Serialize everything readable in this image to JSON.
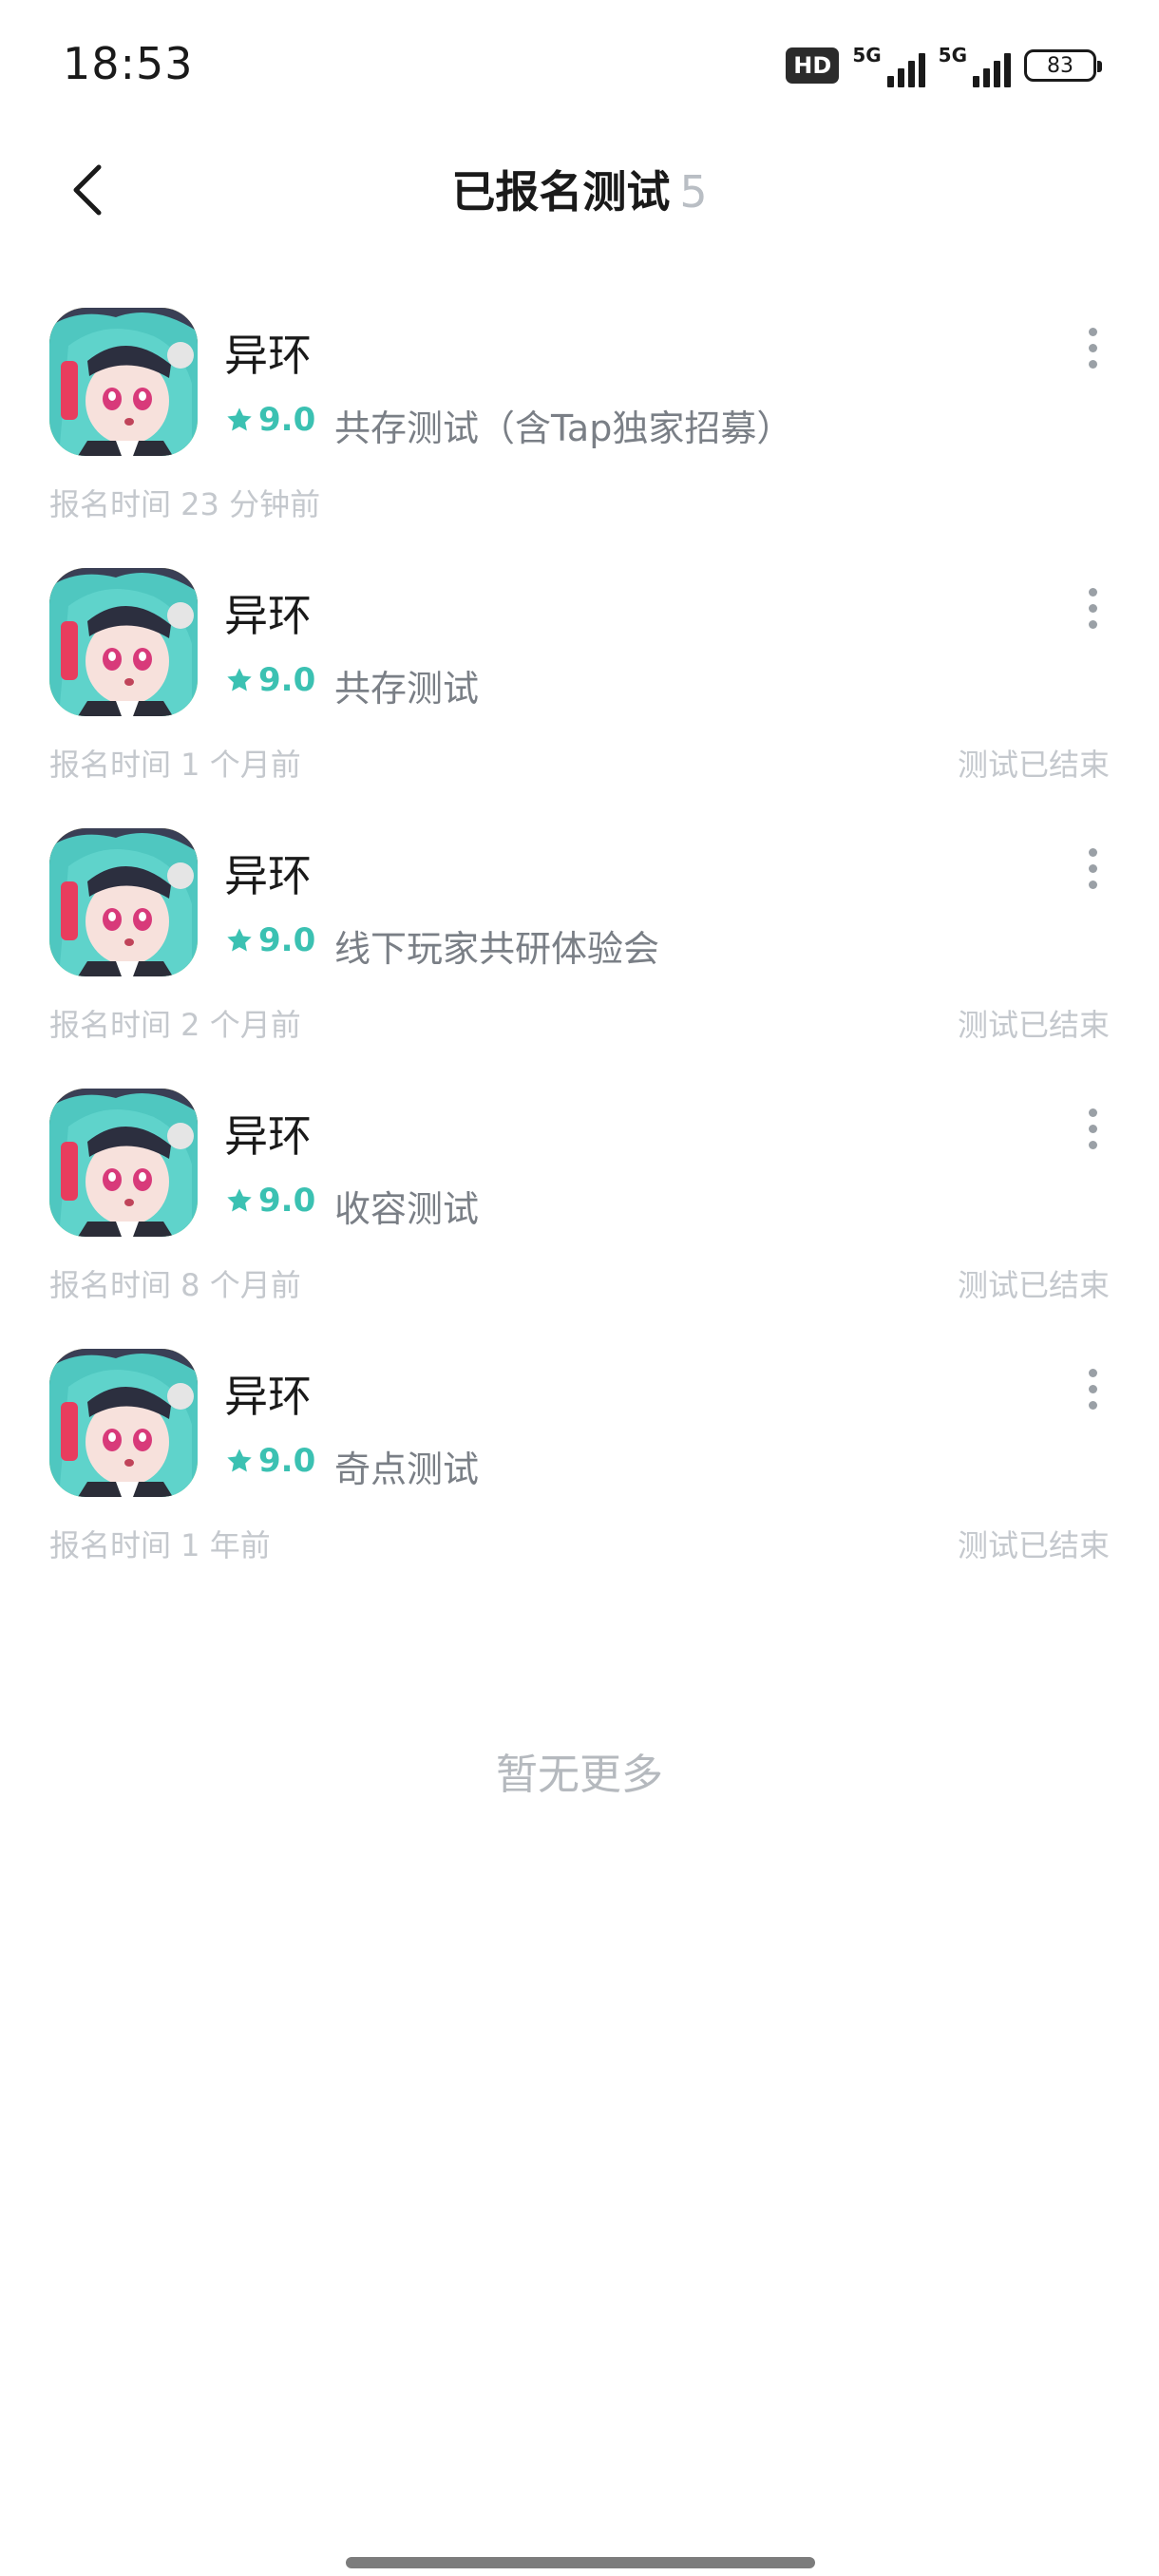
{
  "status_bar": {
    "time": "18:53",
    "hd_label": "HD",
    "network_1": "5G",
    "network_2": "5G",
    "battery": "83"
  },
  "header": {
    "title": "已报名测试",
    "count": "5",
    "back_icon": "chevron-left-icon"
  },
  "items": [
    {
      "app_name": "异环",
      "rating": "9.0",
      "test_name": "共存测试（含Tap独家招募）",
      "signup_time": "报名时间 23 分钟前",
      "status": ""
    },
    {
      "app_name": "异环",
      "rating": "9.0",
      "test_name": "共存测试",
      "signup_time": "报名时间 1 个月前",
      "status": "测试已结束"
    },
    {
      "app_name": "异环",
      "rating": "9.0",
      "test_name": "线下玩家共研体验会",
      "signup_time": "报名时间 2 个月前",
      "status": "测试已结束"
    },
    {
      "app_name": "异环",
      "rating": "9.0",
      "test_name": "收容测试",
      "signup_time": "报名时间 8 个月前",
      "status": "测试已结束"
    },
    {
      "app_name": "异环",
      "rating": "9.0",
      "test_name": "奇点测试",
      "signup_time": "报名时间 1 年前",
      "status": "测试已结束"
    }
  ],
  "footer": {
    "no_more": "暂无更多"
  },
  "colors": {
    "accent": "#3bc1b2",
    "muted_text": "#c4c8cd",
    "secondary_text": "#7a7f86"
  }
}
